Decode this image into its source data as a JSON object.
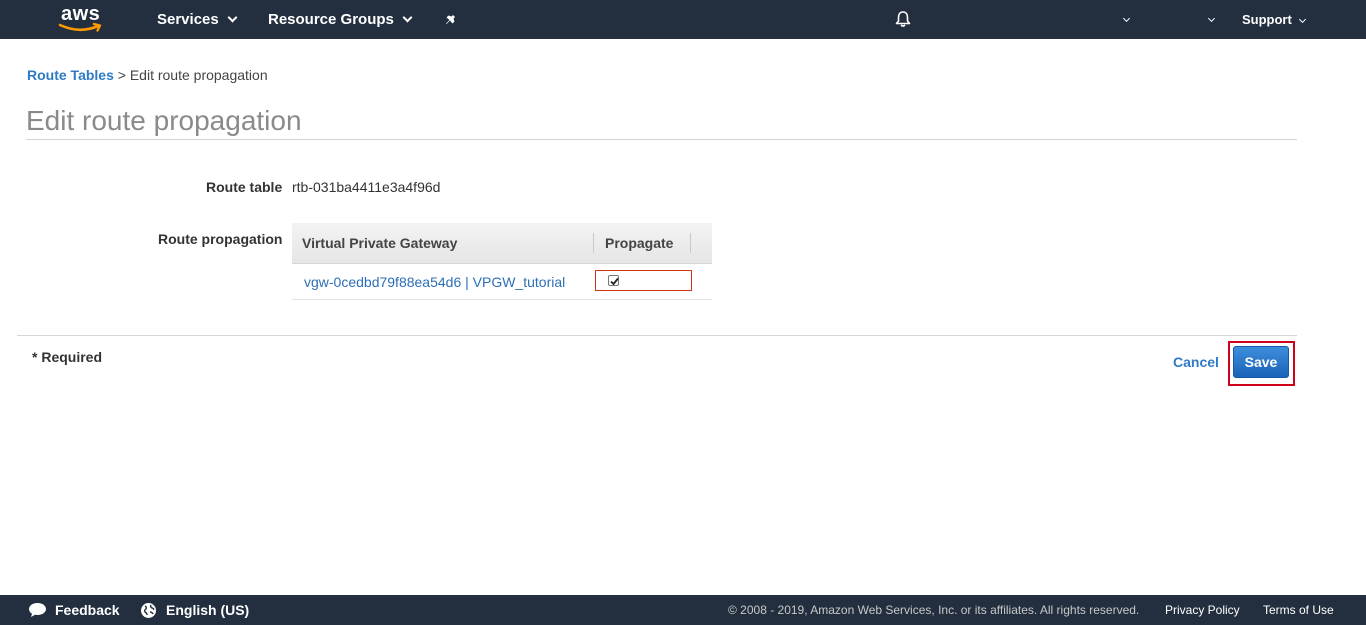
{
  "header": {
    "logo_text": "aws",
    "services_label": "Services",
    "resource_groups_label": "Resource Groups",
    "support_label": "Support"
  },
  "breadcrumb": {
    "parent_label": "Route Tables",
    "separator": ">",
    "current_label": "Edit route propagation"
  },
  "page": {
    "title": "Edit route propagation"
  },
  "form": {
    "route_table_label": "Route table",
    "route_table_value": "rtb-031ba4411e3a4f96d",
    "route_propagation_label": "Route propagation",
    "table": {
      "columns": [
        "Virtual Private Gateway",
        "Propagate"
      ],
      "rows": [
        {
          "gateway": "vgw-0cedbd79f88ea54d6 | VPGW_tutorial",
          "propagate": true
        }
      ]
    }
  },
  "actions": {
    "required_note": "* Required",
    "cancel_label": "Cancel",
    "save_label": "Save"
  },
  "footer": {
    "feedback_label": "Feedback",
    "language_label": "English (US)",
    "copyright": "© 2008 - 2019, Amazon Web Services, Inc. or its affiliates. All rights reserved.",
    "privacy_label": "Privacy Policy",
    "terms_label": "Terms of Use"
  },
  "colors": {
    "nav_bg": "#232f3e",
    "link": "#2d7bc4",
    "primary_button": "#1b63b8",
    "highlight": "#d0021b"
  }
}
